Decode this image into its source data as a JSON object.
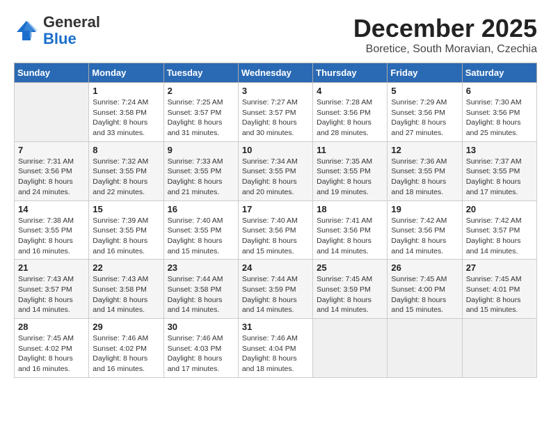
{
  "header": {
    "logo_general": "General",
    "logo_blue": "Blue",
    "month_title": "December 2025",
    "location": "Boretice, South Moravian, Czechia"
  },
  "weekdays": [
    "Sunday",
    "Monday",
    "Tuesday",
    "Wednesday",
    "Thursday",
    "Friday",
    "Saturday"
  ],
  "weeks": [
    [
      {
        "day": "",
        "info": ""
      },
      {
        "day": "1",
        "info": "Sunrise: 7:24 AM\nSunset: 3:58 PM\nDaylight: 8 hours\nand 33 minutes."
      },
      {
        "day": "2",
        "info": "Sunrise: 7:25 AM\nSunset: 3:57 PM\nDaylight: 8 hours\nand 31 minutes."
      },
      {
        "day": "3",
        "info": "Sunrise: 7:27 AM\nSunset: 3:57 PM\nDaylight: 8 hours\nand 30 minutes."
      },
      {
        "day": "4",
        "info": "Sunrise: 7:28 AM\nSunset: 3:56 PM\nDaylight: 8 hours\nand 28 minutes."
      },
      {
        "day": "5",
        "info": "Sunrise: 7:29 AM\nSunset: 3:56 PM\nDaylight: 8 hours\nand 27 minutes."
      },
      {
        "day": "6",
        "info": "Sunrise: 7:30 AM\nSunset: 3:56 PM\nDaylight: 8 hours\nand 25 minutes."
      }
    ],
    [
      {
        "day": "7",
        "info": "Sunrise: 7:31 AM\nSunset: 3:56 PM\nDaylight: 8 hours\nand 24 minutes."
      },
      {
        "day": "8",
        "info": "Sunrise: 7:32 AM\nSunset: 3:55 PM\nDaylight: 8 hours\nand 22 minutes."
      },
      {
        "day": "9",
        "info": "Sunrise: 7:33 AM\nSunset: 3:55 PM\nDaylight: 8 hours\nand 21 minutes."
      },
      {
        "day": "10",
        "info": "Sunrise: 7:34 AM\nSunset: 3:55 PM\nDaylight: 8 hours\nand 20 minutes."
      },
      {
        "day": "11",
        "info": "Sunrise: 7:35 AM\nSunset: 3:55 PM\nDaylight: 8 hours\nand 19 minutes."
      },
      {
        "day": "12",
        "info": "Sunrise: 7:36 AM\nSunset: 3:55 PM\nDaylight: 8 hours\nand 18 minutes."
      },
      {
        "day": "13",
        "info": "Sunrise: 7:37 AM\nSunset: 3:55 PM\nDaylight: 8 hours\nand 17 minutes."
      }
    ],
    [
      {
        "day": "14",
        "info": "Sunrise: 7:38 AM\nSunset: 3:55 PM\nDaylight: 8 hours\nand 16 minutes."
      },
      {
        "day": "15",
        "info": "Sunrise: 7:39 AM\nSunset: 3:55 PM\nDaylight: 8 hours\nand 16 minutes."
      },
      {
        "day": "16",
        "info": "Sunrise: 7:40 AM\nSunset: 3:55 PM\nDaylight: 8 hours\nand 15 minutes."
      },
      {
        "day": "17",
        "info": "Sunrise: 7:40 AM\nSunset: 3:56 PM\nDaylight: 8 hours\nand 15 minutes."
      },
      {
        "day": "18",
        "info": "Sunrise: 7:41 AM\nSunset: 3:56 PM\nDaylight: 8 hours\nand 14 minutes."
      },
      {
        "day": "19",
        "info": "Sunrise: 7:42 AM\nSunset: 3:56 PM\nDaylight: 8 hours\nand 14 minutes."
      },
      {
        "day": "20",
        "info": "Sunrise: 7:42 AM\nSunset: 3:57 PM\nDaylight: 8 hours\nand 14 minutes."
      }
    ],
    [
      {
        "day": "21",
        "info": "Sunrise: 7:43 AM\nSunset: 3:57 PM\nDaylight: 8 hours\nand 14 minutes."
      },
      {
        "day": "22",
        "info": "Sunrise: 7:43 AM\nSunset: 3:58 PM\nDaylight: 8 hours\nand 14 minutes."
      },
      {
        "day": "23",
        "info": "Sunrise: 7:44 AM\nSunset: 3:58 PM\nDaylight: 8 hours\nand 14 minutes."
      },
      {
        "day": "24",
        "info": "Sunrise: 7:44 AM\nSunset: 3:59 PM\nDaylight: 8 hours\nand 14 minutes."
      },
      {
        "day": "25",
        "info": "Sunrise: 7:45 AM\nSunset: 3:59 PM\nDaylight: 8 hours\nand 14 minutes."
      },
      {
        "day": "26",
        "info": "Sunrise: 7:45 AM\nSunset: 4:00 PM\nDaylight: 8 hours\nand 15 minutes."
      },
      {
        "day": "27",
        "info": "Sunrise: 7:45 AM\nSunset: 4:01 PM\nDaylight: 8 hours\nand 15 minutes."
      }
    ],
    [
      {
        "day": "28",
        "info": "Sunrise: 7:45 AM\nSunset: 4:02 PM\nDaylight: 8 hours\nand 16 minutes."
      },
      {
        "day": "29",
        "info": "Sunrise: 7:46 AM\nSunset: 4:02 PM\nDaylight: 8 hours\nand 16 minutes."
      },
      {
        "day": "30",
        "info": "Sunrise: 7:46 AM\nSunset: 4:03 PM\nDaylight: 8 hours\nand 17 minutes."
      },
      {
        "day": "31",
        "info": "Sunrise: 7:46 AM\nSunset: 4:04 PM\nDaylight: 8 hours\nand 18 minutes."
      },
      {
        "day": "",
        "info": ""
      },
      {
        "day": "",
        "info": ""
      },
      {
        "day": "",
        "info": ""
      }
    ]
  ]
}
